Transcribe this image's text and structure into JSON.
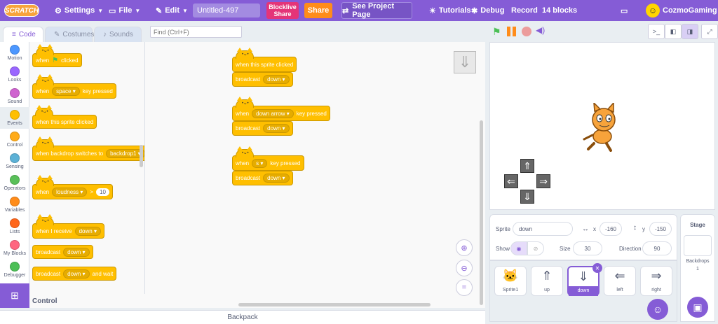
{
  "menubar": {
    "logo": "SCRATCH",
    "settings": "Settings",
    "file": "File",
    "edit": "Edit",
    "project_title": "Untitled-497",
    "blocklive_share": "Blocklive Share",
    "share": "Share",
    "see_project_page": "See Project Page",
    "tutorials": "Tutorials",
    "debug": "Debug",
    "record": "Record",
    "block_count": "14 blocks",
    "username": "CozmoGaming"
  },
  "tabs": {
    "code": "Code",
    "costumes": "Costumes",
    "sounds": "Sounds"
  },
  "find": {
    "placeholder": "Find (Ctrl+F)"
  },
  "categories": [
    {
      "label": "Motion",
      "color": "#4c97ff"
    },
    {
      "label": "Looks",
      "color": "#9966ff"
    },
    {
      "label": "Sound",
      "color": "#cf63cf"
    },
    {
      "label": "Events",
      "color": "#ffbf00"
    },
    {
      "label": "Control",
      "color": "#ffab19"
    },
    {
      "label": "Sensing",
      "color": "#5cb1d6"
    },
    {
      "label": "Operators",
      "color": "#59c059"
    },
    {
      "label": "Variables",
      "color": "#ff8c1a"
    },
    {
      "label": "Lists",
      "color": "#ff661a"
    },
    {
      "label": "My Blocks",
      "color": "#ff6680"
    },
    {
      "label": "Debugger",
      "color": "#4cbf56"
    }
  ],
  "palette": {
    "when": "when",
    "clicked": "clicked",
    "space": "space",
    "key_pressed": "key pressed",
    "when_sprite_clicked": "when this sprite clicked",
    "when_backdrop_switches": "when backdrop switches to",
    "backdrop1": "backdrop1",
    "loudness": "loudness",
    "gt": ">",
    "ten": "10",
    "when_i_receive": "when I receive",
    "down": "down",
    "broadcast": "broadcast",
    "and_wait": "and wait",
    "footer": "Control"
  },
  "workspace": {
    "s1_hat": "when this sprite clicked",
    "s1_broadcast": "broadcast",
    "s1_msg": "down",
    "s2_when": "when",
    "s2_key": "down arrow",
    "s2_pressed": "key pressed",
    "s2_broadcast": "broadcast",
    "s2_msg": "down",
    "s3_when": "when",
    "s3_key": "s",
    "s3_pressed": "key pressed",
    "s3_broadcast": "broadcast",
    "s3_msg": "down"
  },
  "backpack": "Backpack",
  "sprite_info": {
    "sprite_label": "Sprite",
    "sprite_name": "down",
    "x_label": "x",
    "x": "-160",
    "y_label": "y",
    "y": "-150",
    "show_label": "Show",
    "size_label": "Size",
    "size": "30",
    "direction_label": "Direction",
    "direction": "90"
  },
  "sprites": [
    {
      "name": "Sprite1"
    },
    {
      "name": "up"
    },
    {
      "name": "down"
    },
    {
      "name": "left"
    },
    {
      "name": "right"
    }
  ],
  "stage_pane": {
    "title": "Stage",
    "backdrops_label": "Backdrops",
    "backdrops_count": "1"
  }
}
